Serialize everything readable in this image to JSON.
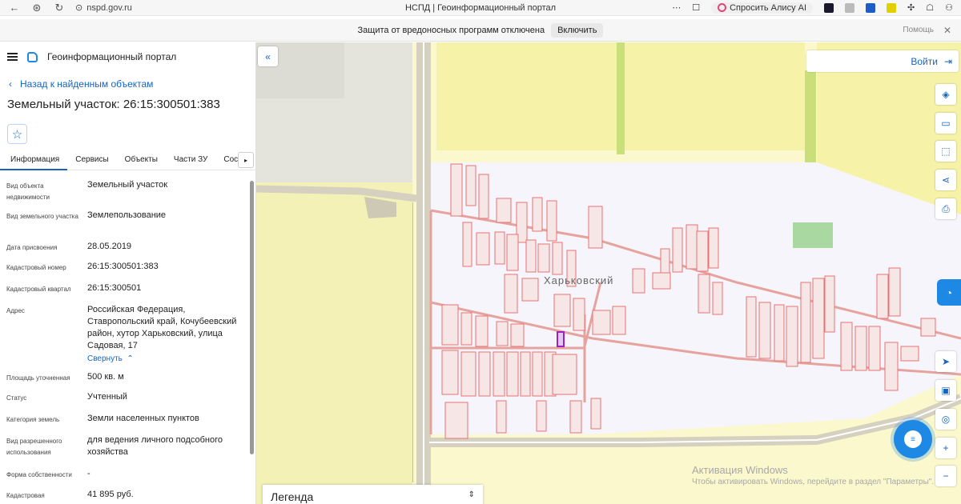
{
  "browser": {
    "url": "nspd.gov.ru",
    "tab_title": "НСПД | Геоинформационный портал",
    "alice_label": "Спросить Алису AI"
  },
  "notice": {
    "text": "Защита от вредоносных программ отключена",
    "enable_label": "Включить",
    "help_label": "Помощь"
  },
  "header": {
    "title": "Геоинформационный портал"
  },
  "panel": {
    "back_label": "Назад к найденным объектам",
    "object_title": "Земельный участок: 26:15:300501:383",
    "tabs": [
      {
        "label": "Информация"
      },
      {
        "label": "Сервисы"
      },
      {
        "label": "Объекты"
      },
      {
        "label": "Части ЗУ"
      },
      {
        "label": "Состав"
      }
    ],
    "fields": [
      {
        "label": "Вид объекта недвижимости",
        "value": "Земельный участок"
      },
      {
        "label": "Вид земельного участка",
        "value": "Землепользование"
      },
      {
        "label": "Дата присвоения",
        "value": "28.05.2019"
      },
      {
        "label": "Кадастровый номер",
        "value": "26:15:300501:383"
      },
      {
        "label": "Кадастровый квартал",
        "value": "26:15:300501"
      },
      {
        "label": "Адрес",
        "value": "Российская Федерация, Ставропольский край, Кочубеевский район, хутор Харьковский, улица Садовая, 17"
      },
      {
        "label": "Площадь уточненная",
        "value": "500 кв. м"
      },
      {
        "label": "Статус",
        "value": "Учтенный"
      },
      {
        "label": "Категория земель",
        "value": "Земли населенных пунктов"
      },
      {
        "label": "Вид разрешенного использования",
        "value": "для ведения личного подсобного хозяйства"
      },
      {
        "label": "Форма собственности",
        "value": "-"
      },
      {
        "label": "Кадастровая",
        "value": "41 895 руб."
      }
    ],
    "collapse_label": "Свернуть"
  },
  "map": {
    "login_label": "Войти",
    "locality_label": "Харьковский",
    "legend_label": "Легенда",
    "watermark_title": "Активация Windows",
    "watermark_text": "Чтобы активировать Windows, перейдите в раздел \"Параметры\".",
    "accent_color": "#1e88e5",
    "selected_parcel_color": "#a020c0",
    "parcel_color": "#e57373"
  }
}
